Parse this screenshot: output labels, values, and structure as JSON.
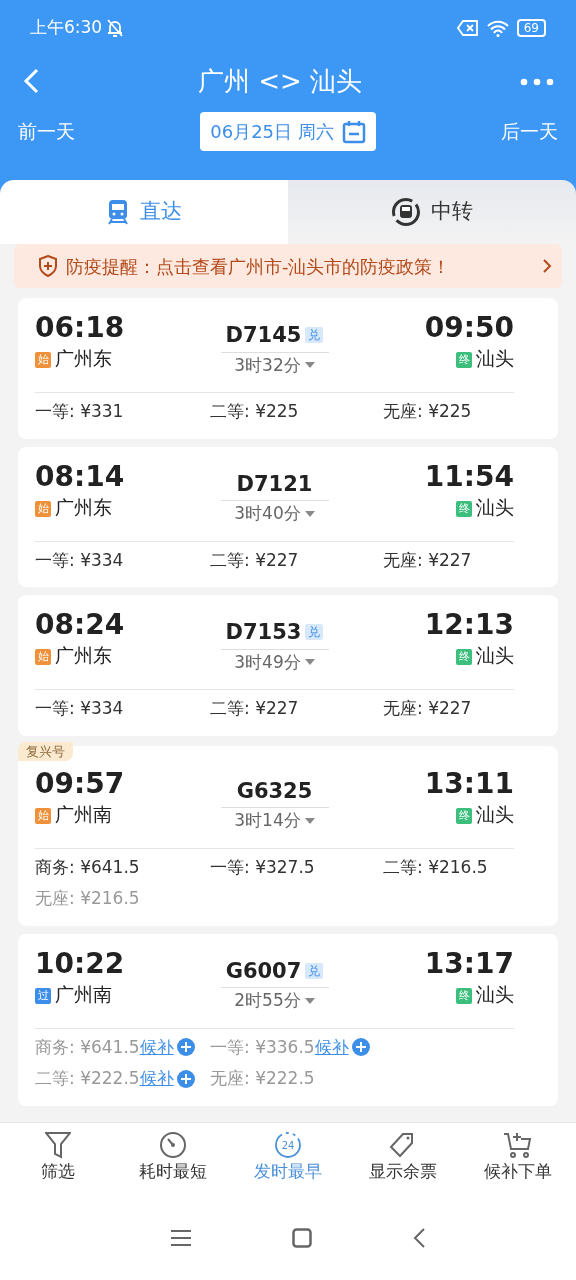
{
  "status_bar": {
    "time": "上午6:30",
    "battery": "69"
  },
  "header": {
    "title": "广州 <> 汕头"
  },
  "date_bar": {
    "prev": "前一天",
    "date": "06月25日 周六",
    "next": "后一天"
  },
  "tabs": [
    {
      "label": "直达",
      "kind": "direct",
      "selected": true
    },
    {
      "label": "中转",
      "kind": "transfer",
      "selected": false
    }
  ],
  "notice": {
    "text": "防疫提醒：点击查看广州市-汕头市的防疫政策！"
  },
  "trains": [
    {
      "depart_time": "06:18",
      "origin_tag": {
        "label": "始",
        "color": "#f0913a"
      },
      "depart_station": "广州东",
      "number": "D7145",
      "exchange_label": "兑",
      "duration": "3时32分",
      "arrive_time": "09:50",
      "terminal_label": "终",
      "arrive_station": "汕头",
      "fares": [
        {
          "text": "一等: ¥331",
          "available": true
        },
        {
          "text": "二等: ¥225",
          "available": true
        },
        {
          "text": "无座: ¥225",
          "available": true
        }
      ]
    },
    {
      "depart_time": "08:14",
      "origin_tag": {
        "label": "始",
        "color": "#f0913a"
      },
      "depart_station": "广州东",
      "number": "D7121",
      "duration": "3时40分",
      "arrive_time": "11:54",
      "terminal_label": "终",
      "arrive_station": "汕头",
      "fares": [
        {
          "text": "一等: ¥334",
          "available": true
        },
        {
          "text": "二等: ¥227",
          "available": true
        },
        {
          "text": "无座: ¥227",
          "available": true
        }
      ]
    },
    {
      "depart_time": "08:24",
      "origin_tag": {
        "label": "始",
        "color": "#f0913a"
      },
      "depart_station": "广州东",
      "number": "D7153",
      "exchange_label": "兑",
      "duration": "3时49分",
      "arrive_time": "12:13",
      "terminal_label": "终",
      "arrive_station": "汕头",
      "fares": [
        {
          "text": "一等: ¥334",
          "available": true
        },
        {
          "text": "二等: ¥227",
          "available": true
        },
        {
          "text": "无座: ¥227",
          "available": true
        }
      ]
    },
    {
      "badge": "复兴号",
      "depart_time": "09:57",
      "origin_tag": {
        "label": "始",
        "color": "#f0913a"
      },
      "depart_station": "广州南",
      "number": "G6325",
      "duration": "3时14分",
      "arrive_time": "13:11",
      "terminal_label": "终",
      "arrive_station": "汕头",
      "fares": [
        {
          "text": "商务: ¥641.5",
          "available": true
        },
        {
          "text": "一等: ¥327.5",
          "available": true
        },
        {
          "text": "二等: ¥216.5",
          "available": true
        },
        {
          "text": "无座: ¥216.5",
          "available": false
        }
      ]
    },
    {
      "depart_time": "10:22",
      "origin_tag": {
        "label": "过",
        "color": "#3d8ee8"
      },
      "depart_station": "广州南",
      "number": "G6007",
      "exchange_label": "兑",
      "duration": "2时55分",
      "arrive_time": "13:17",
      "terminal_label": "终",
      "arrive_station": "汕头",
      "fares": [
        {
          "text": "商务: ¥641.5",
          "available": false,
          "waitlist": "候补"
        },
        {
          "text": "一等: ¥336.5",
          "available": false,
          "waitlist": "候补"
        },
        {
          "text": "二等: ¥222.5",
          "available": false,
          "waitlist": "候补"
        },
        {
          "text": "无座: ¥222.5",
          "available": false
        }
      ]
    }
  ],
  "toolbar": [
    {
      "label": "筛选",
      "kind": "filter",
      "selected": false
    },
    {
      "label": "耗时最短",
      "kind": "duration",
      "selected": false
    },
    {
      "label": "发时最早",
      "kind": "time",
      "icon_text": "24",
      "selected": true
    },
    {
      "label": "显示余票",
      "kind": "tag",
      "selected": false
    },
    {
      "label": "候补下单",
      "kind": "cart",
      "selected": false
    }
  ]
}
